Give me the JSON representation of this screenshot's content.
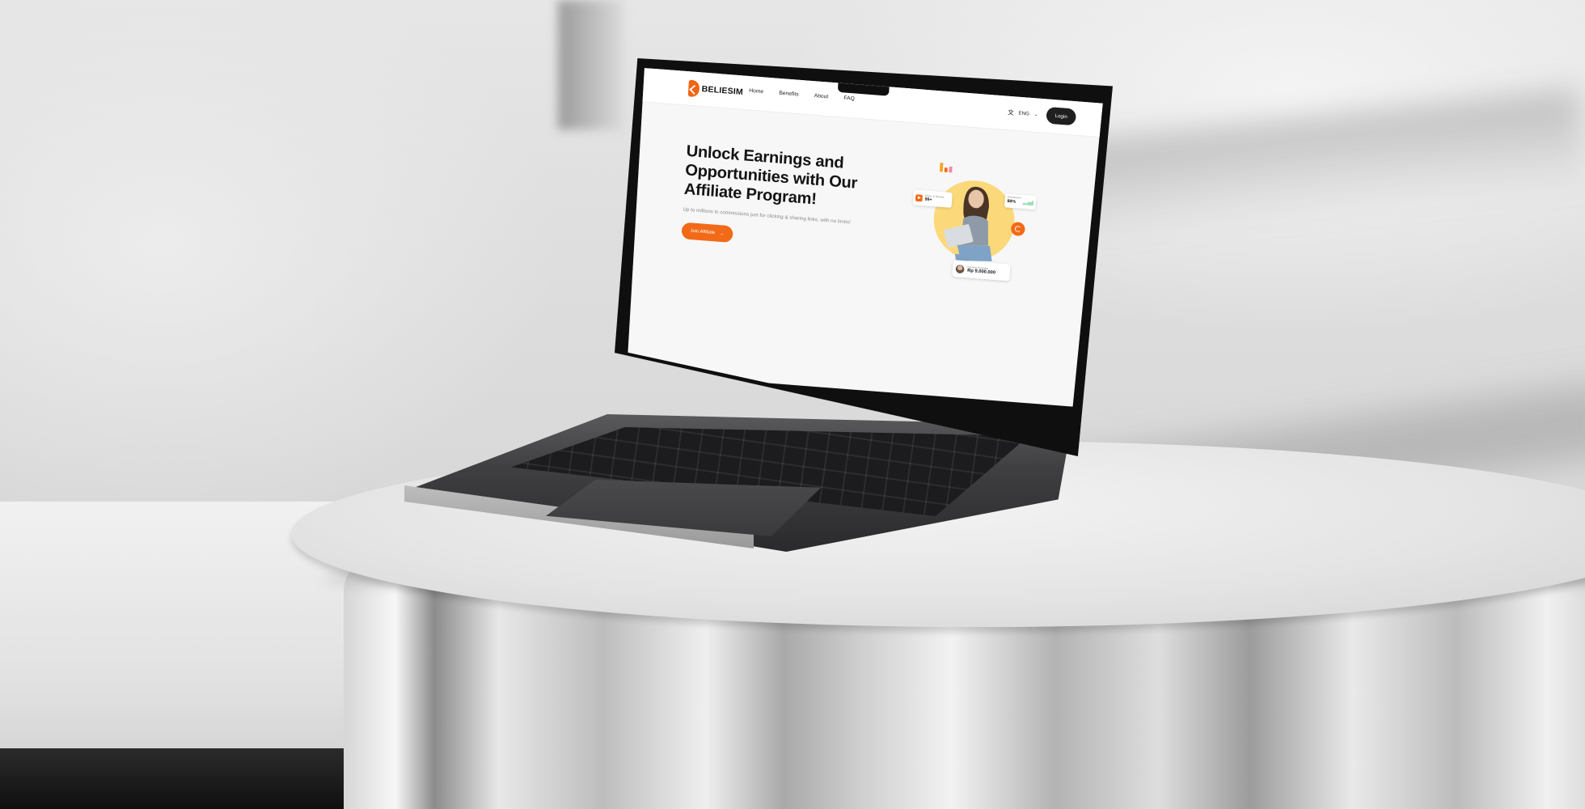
{
  "site": {
    "brand": "BELIESIM",
    "nav": [
      "Home",
      "Benefits",
      "About",
      "FAQ"
    ],
    "language": "ENG",
    "login_label": "Login"
  },
  "hero": {
    "title": "Unlock Earnings and Opportunities with Our Affiliate Program!",
    "subtitle": "Up to millions in commissions just for clicking & sharing links, with no limits!",
    "cta_label": "Join Affiliate",
    "cta_icon": "arrow-right-icon"
  },
  "illustration": {
    "card_a": {
      "label": "Clicks & Shares",
      "value": "99+"
    },
    "card_b": {
      "label": "Conversion",
      "value": "88%"
    },
    "card_c": {
      "label": "Earning Potential",
      "value": "Rp 9.000.000"
    },
    "colors": {
      "accent": "#f26a17",
      "sun": "#fbd97a",
      "bars": [
        "#f5a623",
        "#f26a17",
        "#f08aa0"
      ],
      "chart": "#5cc98b"
    }
  }
}
